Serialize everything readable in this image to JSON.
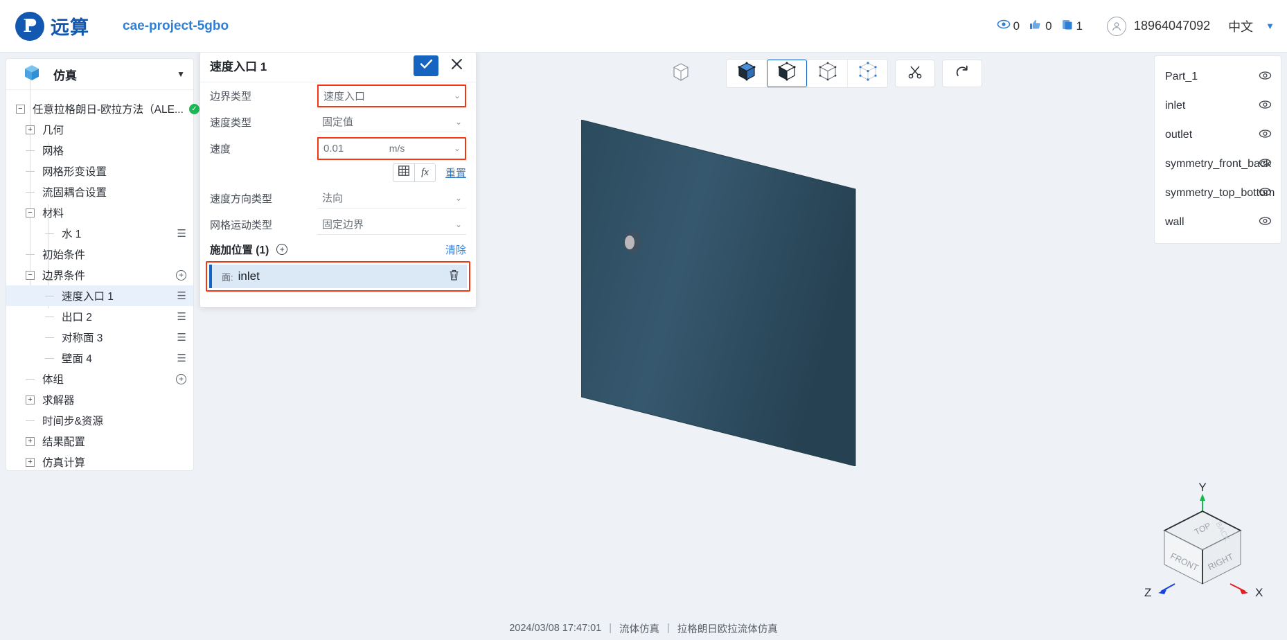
{
  "header": {
    "logo_text": "远算",
    "logo_icon": "yuansuan-logo-icon",
    "project_name": "cae-project-5gbo",
    "stats": [
      {
        "icon": "eye-icon",
        "value": "0"
      },
      {
        "icon": "thumbs-up-icon",
        "value": "0"
      },
      {
        "icon": "copy-icon",
        "value": "1"
      }
    ],
    "user_icon": "user-avatar-icon",
    "user_name": "18964047092",
    "language": "中文",
    "caret_icon": "chevron-down-icon"
  },
  "sidebar": {
    "icon": "cube-icon",
    "title": "仿真",
    "collapse_icon": "chevron-down-icon",
    "tree": [
      {
        "label": "任意拉格朗日-欧拉方法（ALE...",
        "toggle": "minus",
        "depth": 0,
        "badge": "ok"
      },
      {
        "label": "几何",
        "toggle": "plus",
        "depth": 1
      },
      {
        "label": "网格",
        "toggle": "dash",
        "depth": 1
      },
      {
        "label": "网格形变设置",
        "toggle": "dash",
        "depth": 1
      },
      {
        "label": "流固耦合设置",
        "toggle": "dash",
        "depth": 1
      },
      {
        "label": "材料",
        "toggle": "minus",
        "depth": 1
      },
      {
        "label": "水 1",
        "toggle": "dash",
        "depth": 2,
        "menu": true
      },
      {
        "label": "初始条件",
        "toggle": "dash",
        "depth": 1
      },
      {
        "label": "边界条件",
        "toggle": "minus",
        "depth": 1,
        "add": true
      },
      {
        "label": "速度入口 1",
        "toggle": "dash",
        "depth": 2,
        "menu": true,
        "selected": true
      },
      {
        "label": "出口 2",
        "toggle": "dash",
        "depth": 2,
        "menu": true
      },
      {
        "label": "对称面 3",
        "toggle": "dash",
        "depth": 2,
        "menu": true
      },
      {
        "label": "壁面 4",
        "toggle": "dash",
        "depth": 2,
        "menu": true
      },
      {
        "label": "体组",
        "toggle": "dash",
        "depth": 1,
        "add": true
      },
      {
        "label": "求解器",
        "toggle": "plus",
        "depth": 1
      },
      {
        "label": "时间步&资源",
        "toggle": "dash",
        "depth": 1
      },
      {
        "label": "结果配置",
        "toggle": "plus",
        "depth": 1
      },
      {
        "label": "仿真计算",
        "toggle": "plus",
        "depth": 1
      }
    ]
  },
  "properties": {
    "title": "速度入口 1",
    "confirm_icon": "check-icon",
    "close_icon": "close-icon",
    "fields": [
      {
        "label": "边界类型",
        "value": "速度入口",
        "control": "select",
        "highlighted": true
      },
      {
        "label": "速度类型",
        "value": "固定值",
        "control": "select",
        "highlighted": false
      },
      {
        "label": "速度",
        "value": "0.01",
        "control": "input",
        "unit": "m/s",
        "highlighted": true
      },
      {
        "label": "速度方向类型",
        "value": "法向",
        "control": "select",
        "highlighted": false
      },
      {
        "label": "网格运动类型",
        "value": "固定边界",
        "control": "select",
        "highlighted": false
      }
    ],
    "value_tools": {
      "table_icon": "table-icon",
      "formula_icon": "fx-icon",
      "reset_label": "重置"
    },
    "assign_section": {
      "title": "施加位置 (1)",
      "add_icon": "plus-circle-icon",
      "clear_label": "清除",
      "items": [
        {
          "kind": "面:",
          "name": "inlet",
          "delete_icon": "trash-icon"
        }
      ]
    }
  },
  "viewport": {
    "toolbar": [
      {
        "icon": "cube-outline-icon",
        "name": "view-cube",
        "active": false,
        "group": "lone"
      },
      {
        "icon": "solid-shaded-cube-icon",
        "name": "display-solid",
        "active": false,
        "group": "display"
      },
      {
        "icon": "solid-edges-cube-icon",
        "name": "display-solid-edges",
        "active": true,
        "group": "display"
      },
      {
        "icon": "wireframe-cube-icon",
        "name": "display-wireframe",
        "active": false,
        "group": "display"
      },
      {
        "icon": "points-cube-icon",
        "name": "display-points",
        "active": false,
        "group": "display"
      },
      {
        "icon": "scissors-icon",
        "name": "clip-tool",
        "active": false,
        "group": "single"
      },
      {
        "icon": "rotate-reset-icon",
        "name": "reset-view",
        "active": false,
        "group": "single"
      }
    ],
    "nav_cube": {
      "faces": {
        "top": "TOP",
        "front": "FRONT",
        "right": "RIGHT",
        "back": "BACK"
      },
      "axes": {
        "x": "X",
        "y": "Y",
        "z": "Z"
      },
      "axis_colors": {
        "x": "#e02020",
        "y": "#16b84e",
        "z": "#1640e0"
      }
    },
    "model_color": "#2e4f63"
  },
  "parts": {
    "items": [
      {
        "name": "Part_1",
        "visibility_icon": "eye-icon"
      },
      {
        "name": "inlet",
        "visibility_icon": "eye-icon"
      },
      {
        "name": "outlet",
        "visibility_icon": "eye-icon"
      },
      {
        "name": "symmetry_front_back",
        "visibility_icon": "eye-icon"
      },
      {
        "name": "symmetry_top_bottom",
        "visibility_icon": "eye-icon"
      },
      {
        "name": "wall",
        "visibility_icon": "eye-icon"
      }
    ]
  },
  "statusbar": {
    "timestamp": "2024/03/08  17:47:01",
    "category": "流体仿真",
    "solver": "拉格朗日欧拉流体仿真"
  },
  "colors": {
    "accent": "#1565c0",
    "link": "#2f7fd6",
    "highlight_outline": "#f5350e",
    "selected_row": "#e8f1fb",
    "success": "#19b955"
  }
}
